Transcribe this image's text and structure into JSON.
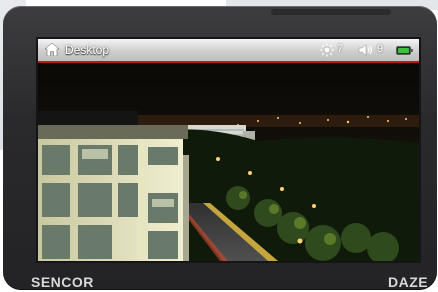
{
  "status_bar": {
    "title": "Desktop",
    "brightness": "7",
    "volume": "9",
    "icons": [
      "home-icon",
      "brightness-icon",
      "volume-icon",
      "battery-icon"
    ]
  },
  "device": {
    "brand": "SENCOR",
    "model": "DAZE"
  },
  "colors": {
    "accent": "#c01818",
    "battery": "#3fbf3f",
    "bezel": "#2a2a2c"
  }
}
